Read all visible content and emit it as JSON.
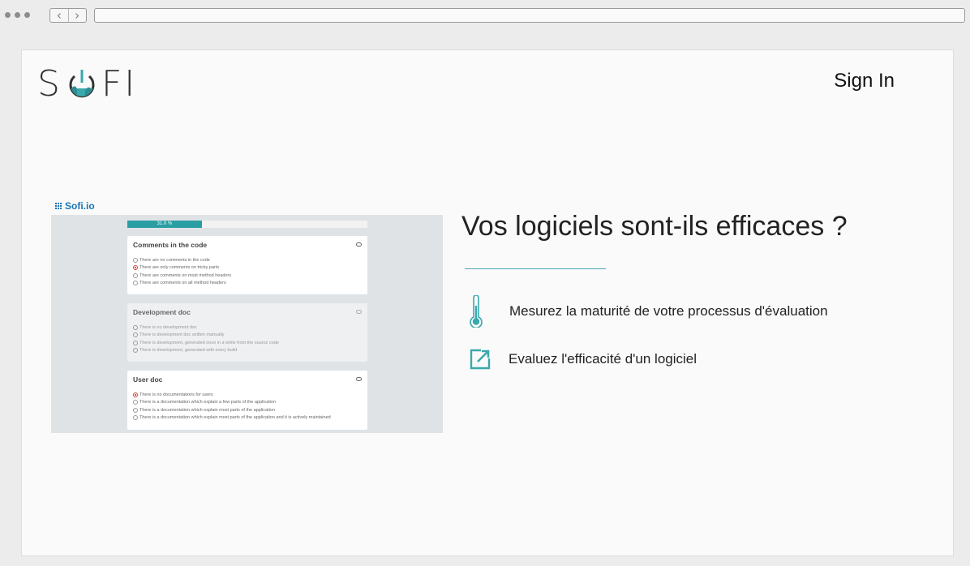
{
  "brand": {
    "logo_text_left": "S",
    "logo_text_right": "FI",
    "color": "#3aa8ad"
  },
  "header": {
    "sign_in": "Sign In"
  },
  "app_preview": {
    "brand": "Sofi.io",
    "progress": {
      "label": "31.0 %",
      "value": 0.31
    },
    "questions": [
      {
        "title": "Comments in the code",
        "enabled": true,
        "options": [
          {
            "label": "There are no comments in the code",
            "checked": false
          },
          {
            "label": "There are only comments on tricky parts",
            "checked": true
          },
          {
            "label": "There are comments on most method headers",
            "checked": false
          },
          {
            "label": "There are comments on all method headers",
            "checked": false
          }
        ]
      },
      {
        "title": "Development doc",
        "enabled": false,
        "options": [
          {
            "label": "There is no development doc",
            "checked": false
          },
          {
            "label": "There is development doc written manually",
            "checked": false
          },
          {
            "label": "There is development, generated once in a while from the source code",
            "checked": false
          },
          {
            "label": "There is development, generated with every build",
            "checked": false
          }
        ]
      },
      {
        "title": "User doc",
        "enabled": true,
        "options": [
          {
            "label": "There is no documentations for users",
            "checked": true
          },
          {
            "label": "There is a documentation which explain a few parts of the application",
            "checked": false
          },
          {
            "label": "There is a documentation which explain most parts of the application",
            "checked": false
          },
          {
            "label": "There is a documentation which explain most parts of the application and it is actively maintained",
            "checked": false
          }
        ]
      }
    ]
  },
  "hero": {
    "headline": "Vos logiciels sont-ils efficaces ?",
    "features": [
      {
        "icon": "thermometer-icon",
        "text": "Mesurez la maturité de votre processus d'évaluation"
      },
      {
        "icon": "external-link-icon",
        "text": "Evaluez l'efficacité d'un logiciel"
      }
    ]
  },
  "colors": {
    "accent": "#3aa8ad",
    "radio_checked": "#d7413d",
    "app_brand": "#1a76b3"
  }
}
